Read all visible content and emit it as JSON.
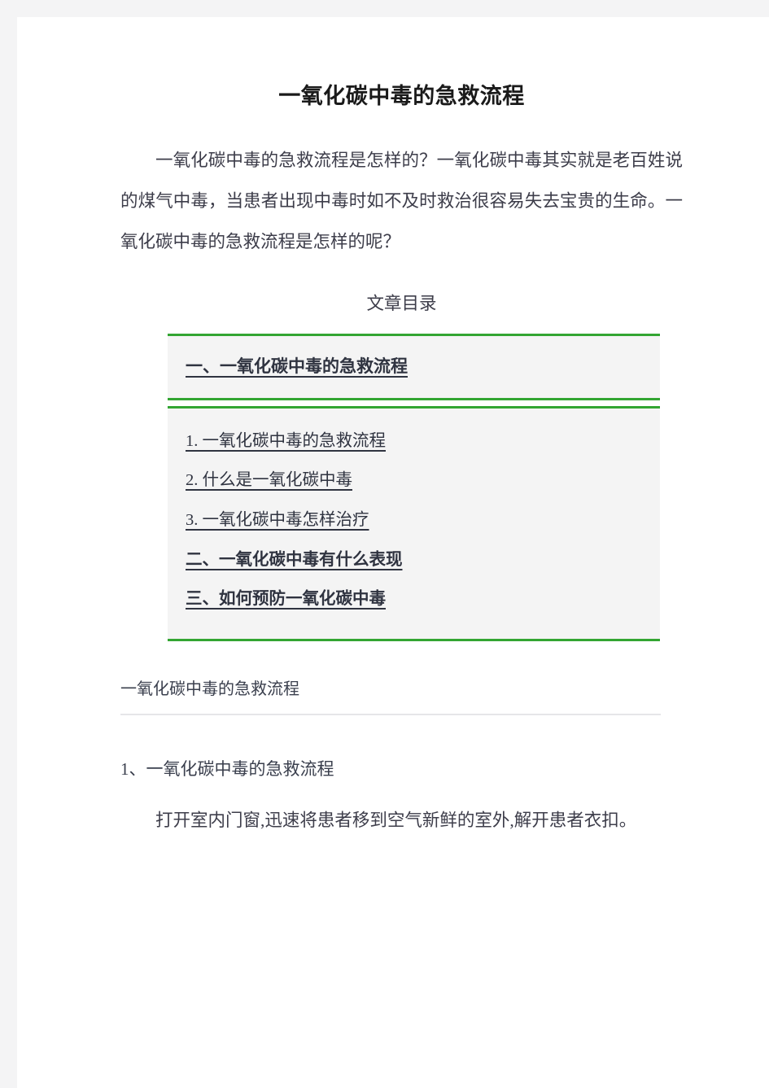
{
  "document": {
    "title": "一氧化碳中毒的急救流程",
    "intro_paragraph": "一氧化碳中毒的急救流程是怎样的？一氧化碳中毒其实就是老百姓说的煤气中毒，当患者出现中毒时如不及时救治很容易失去宝贵的生命。一氧化碳中毒的急救流程是怎样的呢？",
    "toc_label": "文章目录"
  },
  "toc": {
    "primary_heading": "一、一氧化碳中毒的急救流程",
    "items": [
      {
        "label": "1. 一氧化碳中毒的急救流程",
        "style": "numbered"
      },
      {
        "label": "2. 什么是一氧化碳中毒",
        "style": "numbered"
      },
      {
        "label": "3. 一氧化碳中毒怎样治疗",
        "style": "numbered"
      },
      {
        "label": "二、一氧化碳中毒有什么表现",
        "style": "bold"
      },
      {
        "label": "三、如何预防一氧化碳中毒",
        "style": "bold"
      }
    ]
  },
  "section": {
    "heading": "一氧化碳中毒的急救流程",
    "sub_heading": "1、一氧化碳中毒的急救流程",
    "paragraph": "打开室内门窗,迅速将患者移到空气新鲜的室外,解开患者衣扣。"
  },
  "colors": {
    "accent_green": "#33a532",
    "page_background": "#ffffff",
    "canvas_background": "#f4f4f5",
    "toc_background": "#f4f4f4",
    "body_text": "#3d3d4a",
    "divider": "#e6e6e8"
  }
}
